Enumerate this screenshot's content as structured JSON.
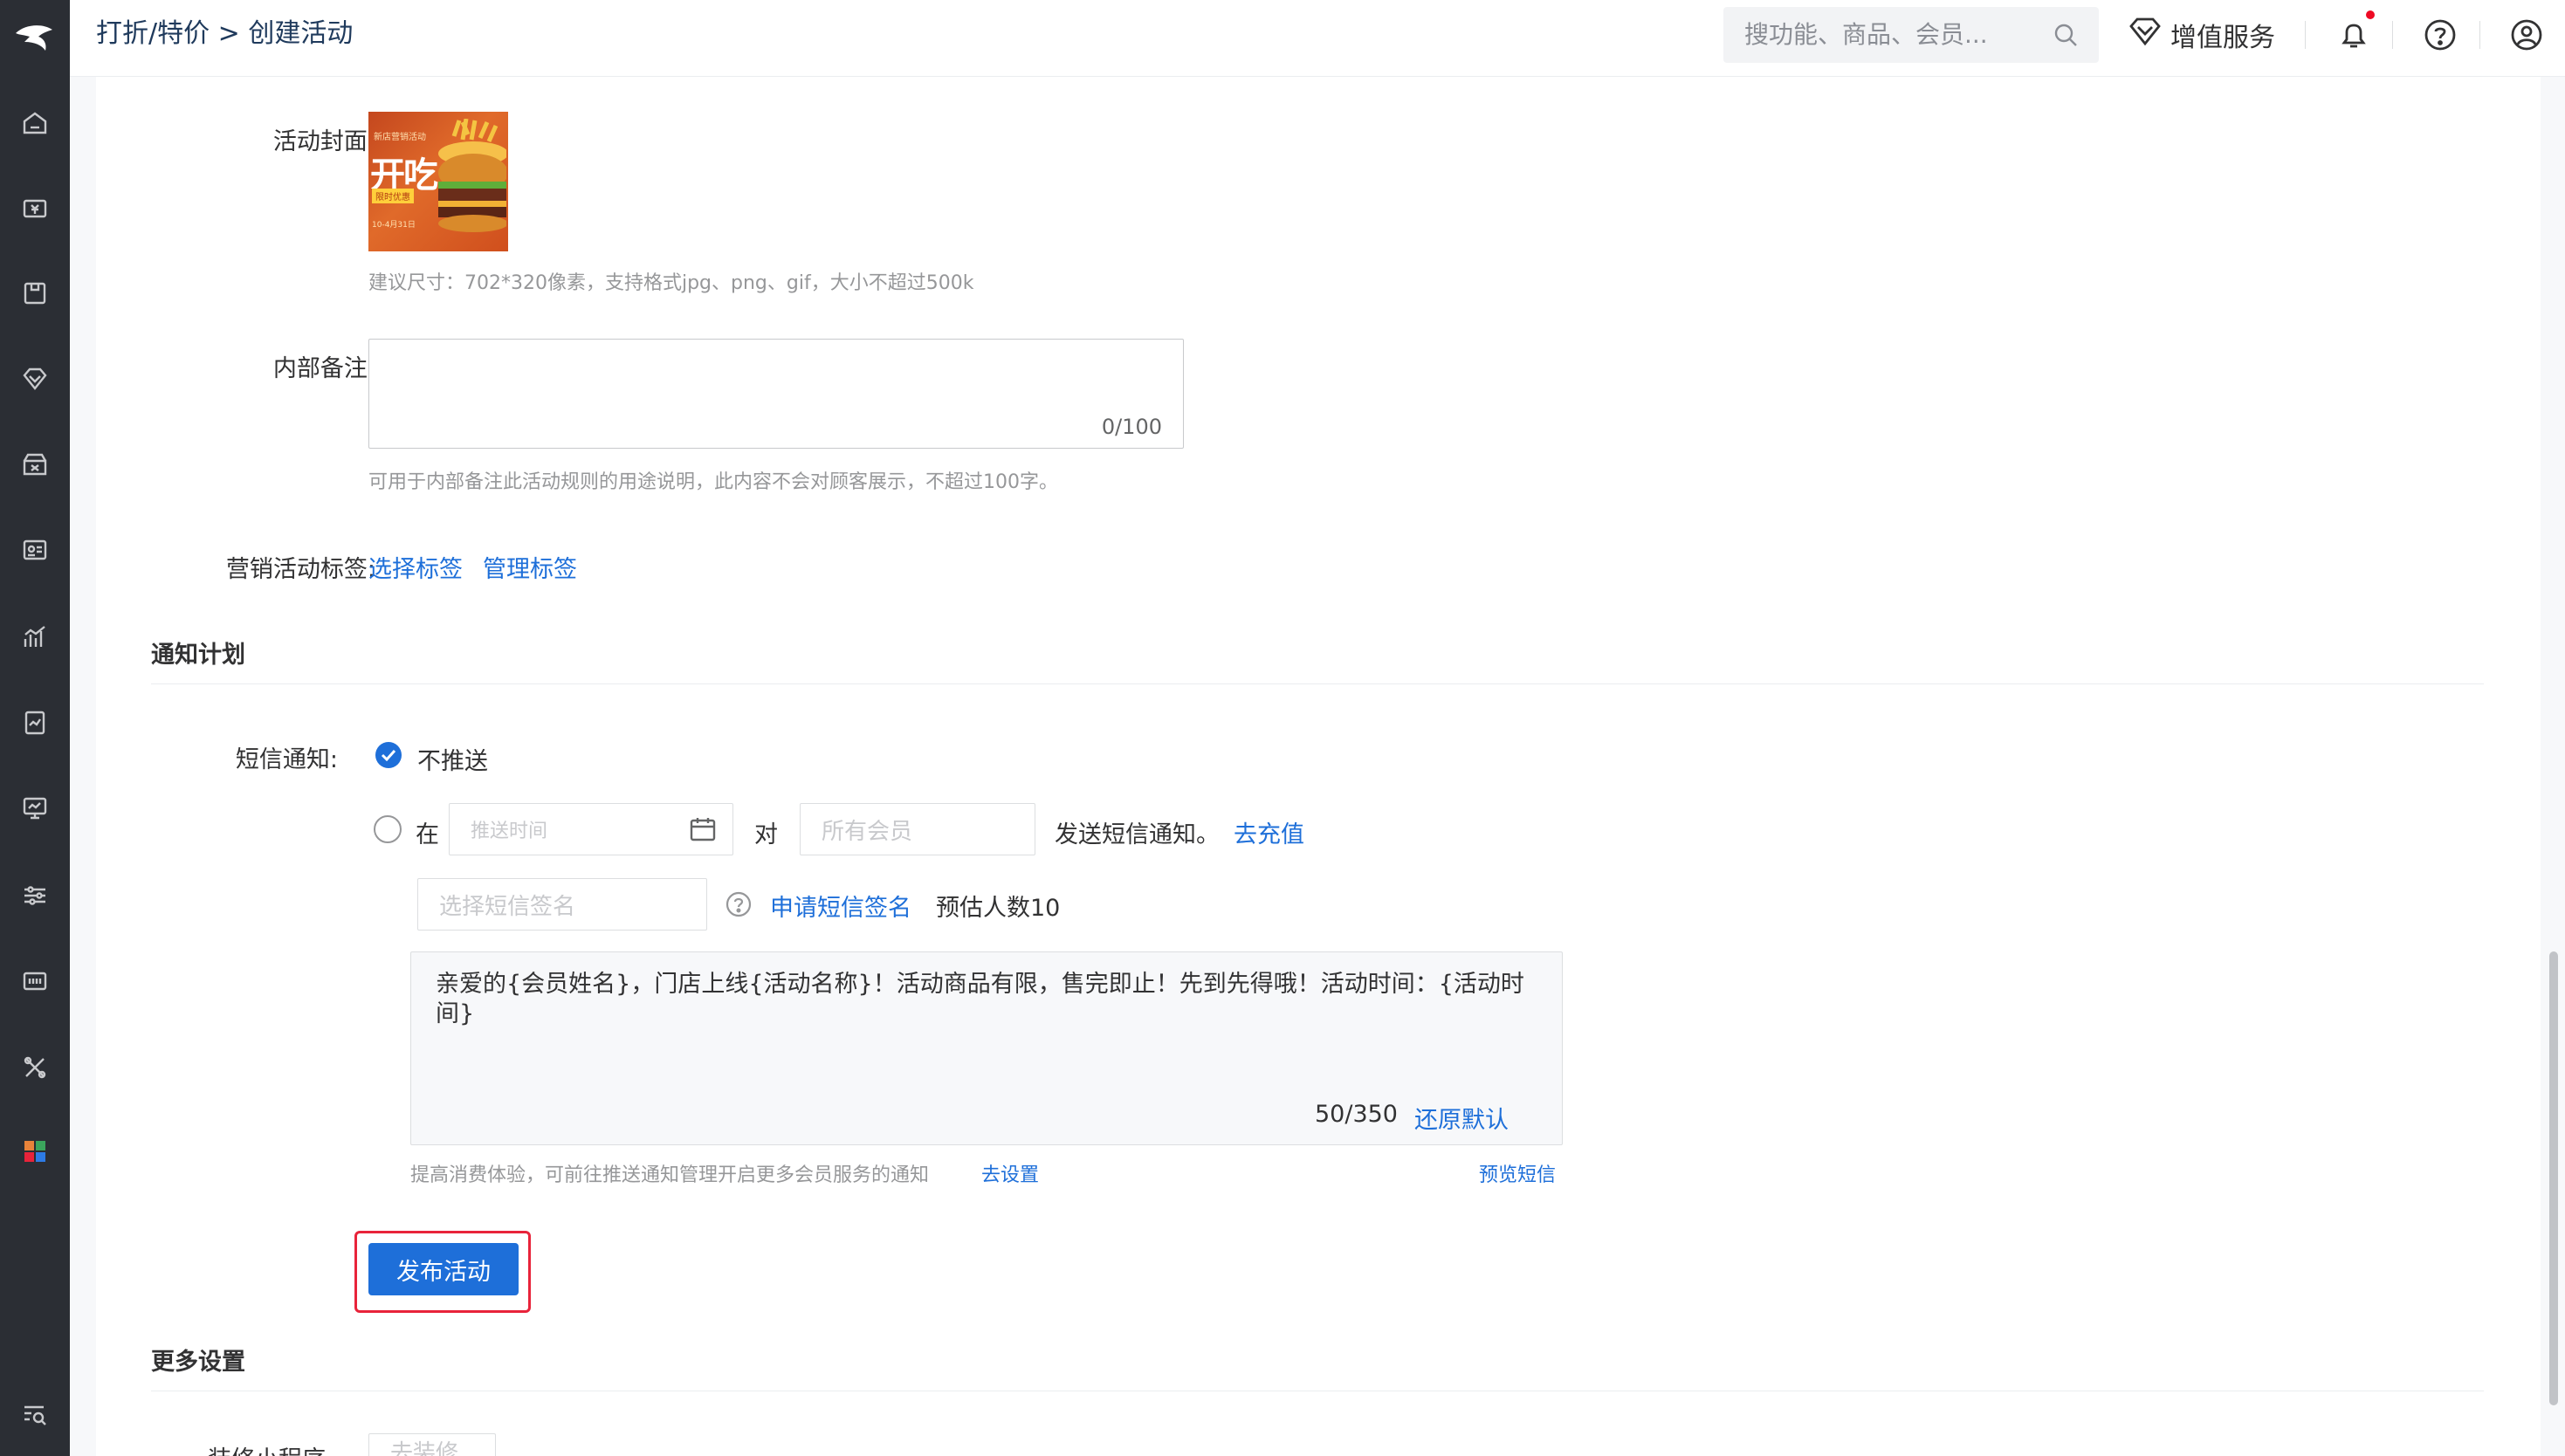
{
  "header": {
    "breadcrumb_parent": "打折/特价",
    "breadcrumb_sep": " > ",
    "breadcrumb_current": "创建活动",
    "search_placeholder": "搜功能、商品、会员...",
    "value_added_label": "增值服务"
  },
  "sidebar": {
    "icons": [
      "home-icon",
      "cashier-icon",
      "goods-icon",
      "member-icon",
      "marketing-icon",
      "staff-icon",
      "data-icon",
      "report-icon",
      "monitor-icon",
      "settings-icon",
      "hardware-icon",
      "tools-icon",
      "apps-icon",
      "search-menu-icon"
    ]
  },
  "form": {
    "cover_label": "活动封面:",
    "cover_image": {
      "line1": "新店营销活动",
      "line2": "开吃",
      "line3": "限时优惠",
      "line4": "10-4月31日"
    },
    "cover_hint": "建议尺寸：702*320像素，支持格式jpg、png、gif，大小不超过500k",
    "note_label": "内部备注:",
    "note_counter": "0/100",
    "note_hint": "可用于内部备注此活动规则的用途说明，此内容不会对顾客展示，不超过100字。",
    "tag_label": "营销活动标签:",
    "tag_select_link": "选择标签",
    "tag_manage_link": "管理标签"
  },
  "notify": {
    "section_title": "通知计划",
    "sms_label": "短信通知:",
    "option_no_push": "不推送",
    "option_at": "在",
    "push_time_placeholder": "推送时间",
    "to_label": "对",
    "audience_placeholder": "所有会员",
    "send_text": "发送短信通知。",
    "recharge_link": "去充值",
    "signature_placeholder": "选择短信签名",
    "apply_signature_link": "申请短信签名",
    "estimated_count": "预估人数10",
    "sms_content": "亲爱的{会员姓名}，门店上线{活动名称}！活动商品有限，售完即止！先到先得哦！活动时间：{活动时间}",
    "sms_counter": "50/350",
    "restore_default_link": "还原默认",
    "experience_hint": "提高消费体验，可前往推送通知管理开启更多会员服务的通知",
    "go_settings_link": "去设置",
    "preview_sms_link": "预览短信"
  },
  "actions": {
    "publish_label": "发布活动"
  },
  "more": {
    "section_title": "更多设置",
    "partial_label": "装修小程序",
    "partial_button": "去装修"
  },
  "colors": {
    "primary": "#1e6fd9",
    "sidebar": "#2b2e34",
    "highlight": "#e8233a"
  }
}
